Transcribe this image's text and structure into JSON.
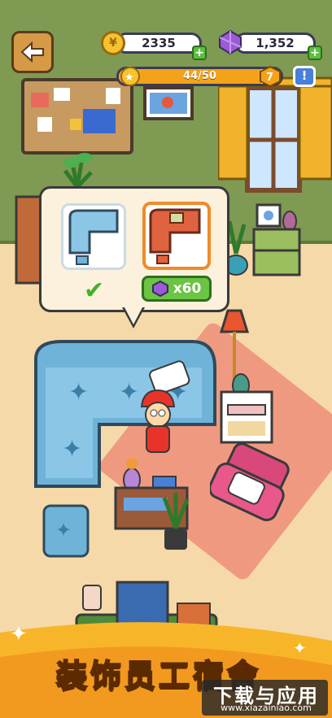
{
  "hud": {
    "coins": "2335",
    "gems": "1,352",
    "xp_text": "44/50",
    "xp_fraction": 0.88,
    "level": "7",
    "info_label": "!"
  },
  "furniture_popup": {
    "price": "x60",
    "selected_option": "blue-sofa"
  },
  "banner": {
    "title": "装饰员工宿舍"
  },
  "watermark": {
    "main": "下载与应用",
    "sub": "www.xiazainiao.com"
  },
  "colors": {
    "wall": "#7e9a53",
    "floor": "#f6d9a8",
    "sofa_blue": "#6fb3d9",
    "sofa_red": "#e0633f",
    "accent_orange": "#f08a2a",
    "button_green": "#6bc443"
  }
}
